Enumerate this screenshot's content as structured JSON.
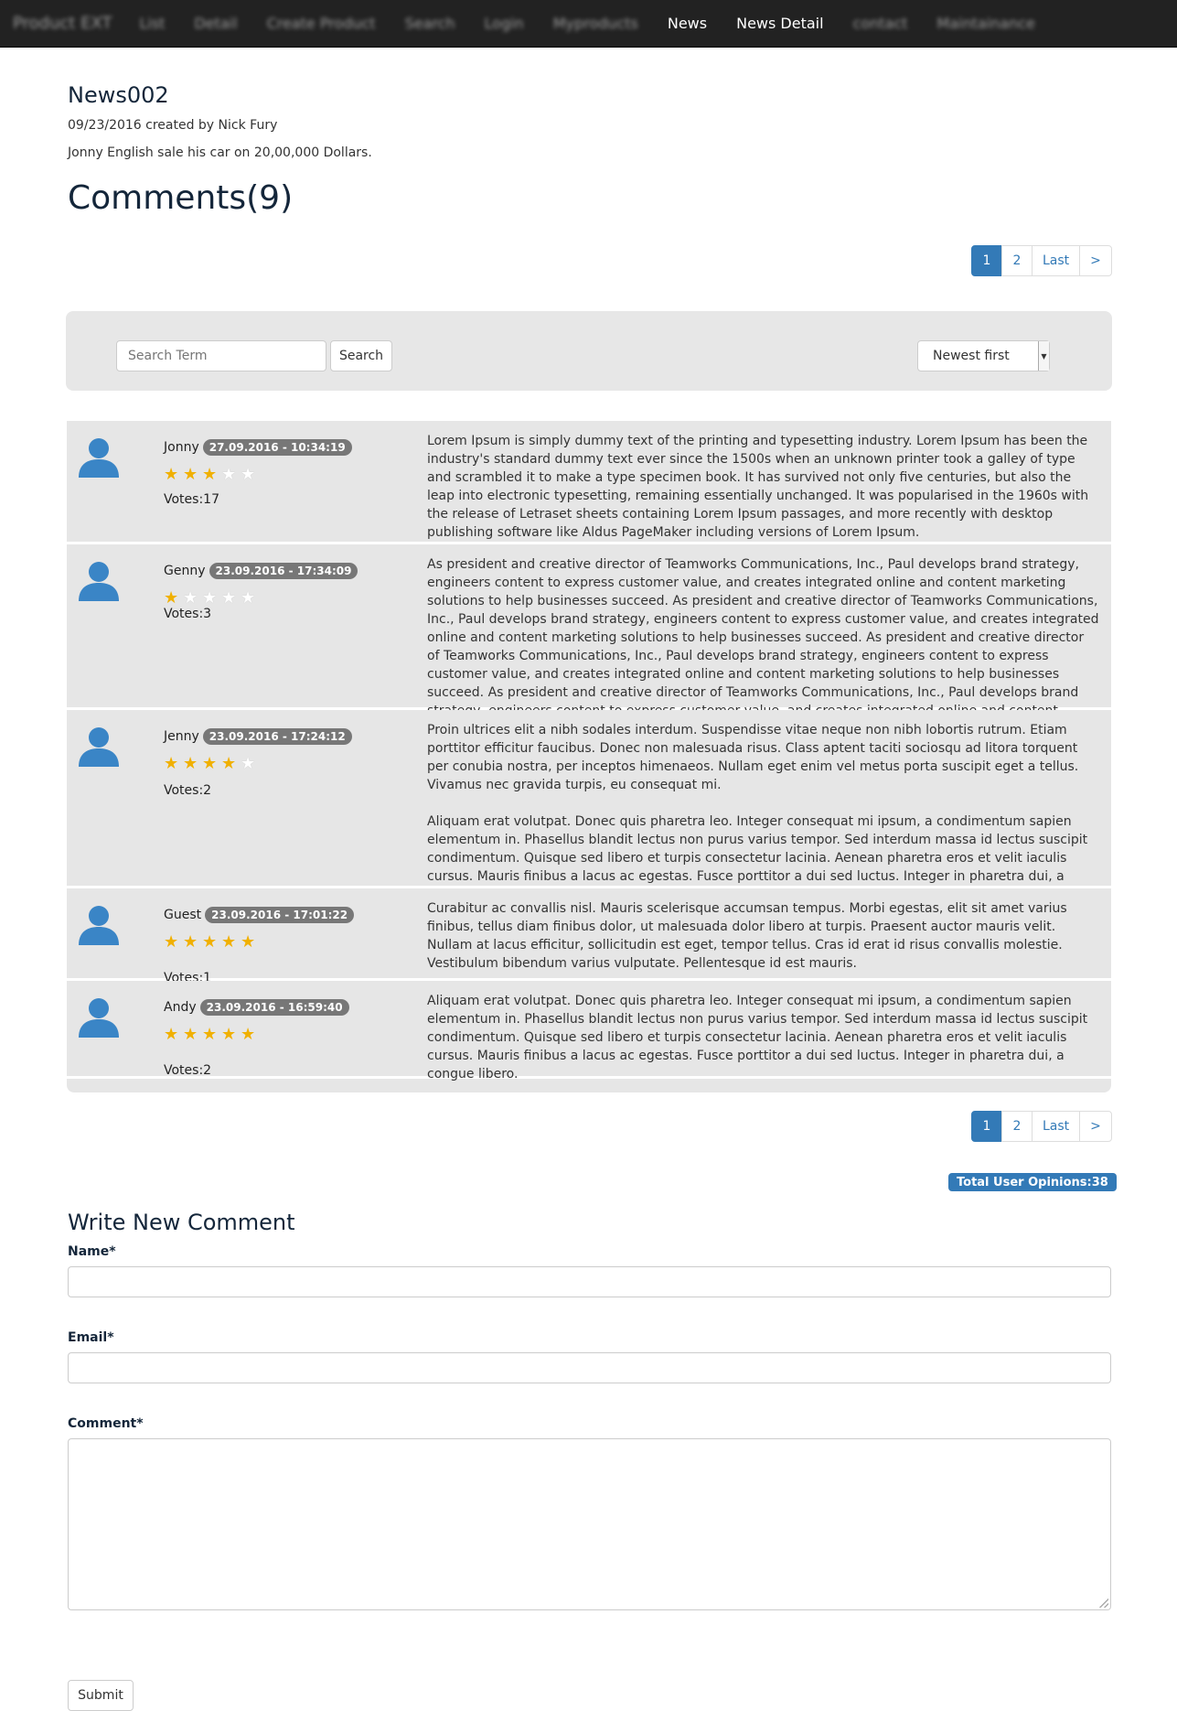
{
  "navbar": {
    "brand": "Product EXT",
    "items": [
      {
        "label": "List",
        "blurred": true
      },
      {
        "label": "Detail",
        "blurred": true
      },
      {
        "label": "Create Product",
        "blurred": true
      },
      {
        "label": "Search",
        "blurred": true
      },
      {
        "label": "Login",
        "blurred": true
      },
      {
        "label": "Myproducts",
        "blurred": true
      },
      {
        "label": "News",
        "blurred": false
      },
      {
        "label": "News Detail",
        "blurred": false
      },
      {
        "label": "contact",
        "blurred": true
      },
      {
        "label": "Maintainance",
        "blurred": true
      }
    ]
  },
  "news": {
    "title": "News002",
    "meta": "09/23/2016 created by Nick Fury",
    "body": "Jonny English sale his car on 20,00,000 Dollars."
  },
  "comments_heading": "Comments(9)",
  "pagination": {
    "pages": [
      "1",
      "2",
      "Last",
      ">"
    ],
    "active": "1"
  },
  "search": {
    "placeholder": "Search Term",
    "button": "Search",
    "sort": "Newest first"
  },
  "comments": [
    {
      "author": "Jonny",
      "date": "27.09.2016 - 10:34:19",
      "rating": 3,
      "votes": "Votes:17",
      "paragraphs": [
        "Lorem Ipsum is simply dummy text of the printing and typesetting industry. Lorem Ipsum has been the industry's standard dummy text ever since the 1500s when an unknown printer took a galley of type and scrambled it to make a type specimen book. It has survived not only five centuries, but also the leap into electronic typesetting, remaining essentially unchanged. It was popularised in the 1960s with the release of Letraset sheets containing Lorem Ipsum passages, and more recently with desktop publishing software like Aldus PageMaker including versions of Lorem Ipsum."
      ]
    },
    {
      "author": "Genny",
      "date": "23.09.2016 - 17:34:09",
      "rating": 1,
      "votes": "Votes:3",
      "paragraphs": [
        "As president and creative director of Teamworks Communications, Inc., Paul develops brand strategy, engineers content to express customer value, and creates integrated online and content marketing solutions to help businesses succeed. As president and creative director of Teamworks Communications, Inc., Paul develops brand strategy, engineers content to express customer value, and creates integrated online and content marketing solutions to help businesses succeed. As president and creative director of Teamworks Communications, Inc., Paul develops brand strategy, engineers content to express customer value, and creates integrated online and content marketing solutions to help businesses succeed. As president and creative director of Teamworks Communications, Inc., Paul develops brand strategy, engineers content to express customer value, and creates integrated online and content marketing solutions to help businesses succeed."
      ]
    },
    {
      "author": "Jenny",
      "date": "23.09.2016 - 17:24:12",
      "rating": 4,
      "votes": "Votes:2",
      "paragraphs": [
        "Proin ultrices elit a nibh sodales interdum. Suspendisse vitae neque non nibh lobortis rutrum. Etiam porttitor efficitur faucibus. Donec non malesuada risus. Class aptent taciti sociosqu ad litora torquent per conubia nostra, per inceptos himenaeos. Nullam eget enim vel metus porta suscipit eget a tellus. Vivamus nec gravida turpis, eu consequat mi.",
        "Aliquam erat volutpat. Donec quis pharetra leo. Integer consequat mi ipsum, a condimentum sapien elementum in. Phasellus blandit lectus non purus varius tempor. Sed interdum massa id lectus suscipit condimentum. Quisque sed libero et turpis consectetur lacinia. Aenean pharetra eros et velit iaculis cursus. Mauris finibus a lacus ac egestas. Fusce porttitor a dui sed luctus. Integer in pharetra dui, a congue libero."
      ]
    },
    {
      "author": "Guest",
      "date": "23.09.2016 - 17:01:22",
      "rating": 5,
      "votes": "Votes:1",
      "paragraphs": [
        "Curabitur ac convallis nisl. Mauris scelerisque accumsan tempus. Morbi egestas, elit sit amet varius finibus, tellus diam finibus dolor, ut malesuada dolor libero at turpis. Praesent auctor mauris velit. Nullam at lacus efficitur, sollicitudin est eget, tempor tellus. Cras id erat id risus convallis molestie. Vestibulum bibendum varius vulputate. Pellentesque id est mauris."
      ]
    },
    {
      "author": "Andy",
      "date": "23.09.2016 - 16:59:40",
      "rating": 5,
      "votes": "Votes:2",
      "paragraphs": [
        "Aliquam erat volutpat. Donec quis pharetra leo. Integer consequat mi ipsum, a condimentum sapien elementum in. Phasellus blandit lectus non purus varius tempor. Sed interdum massa id lectus suscipit condimentum. Quisque sed libero et turpis consectetur lacinia. Aenean pharetra eros et velit iaculis cursus. Mauris finibus a lacus ac egestas. Fusce porttitor a dui sed luctus. Integer in pharetra dui, a congue libero."
      ]
    }
  ],
  "total_opinions": "Total User Opinions:38",
  "form": {
    "heading": "Write New Comment",
    "name_label": "Name*",
    "email_label": "Email*",
    "comment_label": "Comment*",
    "submit": "Submit"
  },
  "icons": {
    "avatar": "user-avatar-icon",
    "star": "star-icon",
    "sort_arrow": "dropdown-arrow-icon"
  },
  "colors": {
    "navbar_bg": "#222222",
    "accent": "#337ab7",
    "star": "#f0b000",
    "avatar": "#3a85c6",
    "panel_bg": "#e6e6e6"
  }
}
